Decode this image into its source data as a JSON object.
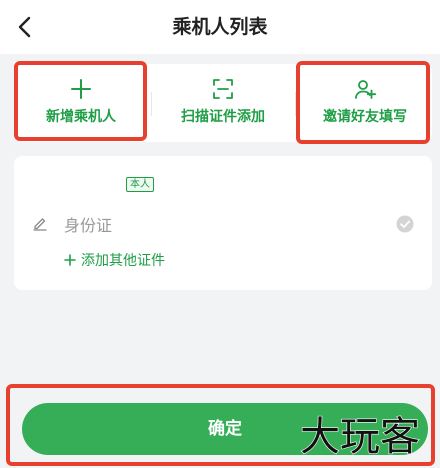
{
  "header": {
    "title": "乘机人列表",
    "back_icon": "chevron-left-icon"
  },
  "actions": [
    {
      "label": "新增乘机人",
      "icon": "plus-icon"
    },
    {
      "label": "扫描证件添加",
      "icon": "scan-icon"
    },
    {
      "label": "邀请好友填写",
      "icon": "user-add-icon"
    }
  ],
  "passenger": {
    "badge": "本人",
    "id_label": "身份证",
    "add_document": "添加其他证件"
  },
  "footer": {
    "confirm_label": "确定"
  },
  "watermark": "大玩客",
  "colors": {
    "accent": "#1f9e46",
    "button": "#36ae57",
    "highlight": "#e8402f"
  }
}
